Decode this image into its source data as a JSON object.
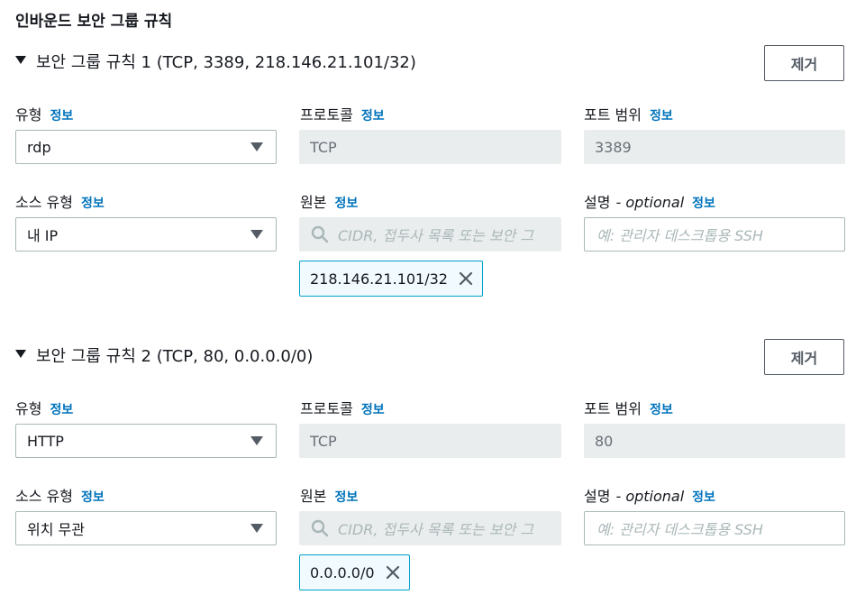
{
  "section_title": "인바운드 보안 그룹 규칙",
  "info_label": "정보",
  "optional_label": "- optional",
  "rules": [
    {
      "header": "보안 그룹 규칙 1 (TCP, 3389, 218.146.21.101/32)",
      "remove_label": "제거",
      "type_label": "유형",
      "type_value": "rdp",
      "protocol_label": "프로토콜",
      "protocol_value": "TCP",
      "port_label": "포트 범위",
      "port_value": "3389",
      "source_type_label": "소스 유형",
      "source_type_value": "내 IP",
      "source_label": "원본",
      "source_placeholder": "CIDR, 접두사 목록 또는 보안 그",
      "source_token": "218.146.21.101/32",
      "desc_label": "설명",
      "desc_placeholder": "예: 관리자 데스크톱용 SSH"
    },
    {
      "header": "보안 그룹 규칙 2 (TCP, 80, 0.0.0.0/0)",
      "remove_label": "제거",
      "type_label": "유형",
      "type_value": "HTTP",
      "protocol_label": "프로토콜",
      "protocol_value": "TCP",
      "port_label": "포트 범위",
      "port_value": "80",
      "source_type_label": "소스 유형",
      "source_type_value": "위치 무관",
      "source_label": "원본",
      "source_placeholder": "CIDR, 접두사 목록 또는 보안 그",
      "source_token": "0.0.0.0/0",
      "desc_label": "설명",
      "desc_placeholder": "예: 관리자 데스크톱용 SSH"
    }
  ],
  "colors": {
    "link": "#0073bb",
    "token_border": "#00a1c9",
    "readonly_bg": "#eaeded"
  }
}
